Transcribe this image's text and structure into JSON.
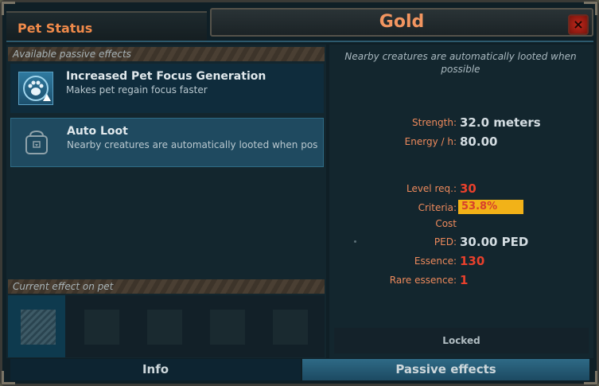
{
  "header": {
    "title": "Pet Status",
    "item_name": "Gold",
    "close_label": "×"
  },
  "available": {
    "heading": "Available passive effects",
    "effects": [
      {
        "name": "Increased Pet Focus Generation",
        "description": "Makes pet regain focus faster",
        "icon": "paw-icon"
      },
      {
        "name": "Auto Loot",
        "description": "Nearby creatures are automatically looted when possible",
        "icon": "loot-bag-icon"
      }
    ]
  },
  "current": {
    "heading": "Current effect on pet"
  },
  "details": {
    "description": "Nearby creatures are automatically looted when possible",
    "strength_label": "Strength:",
    "strength_value": "32.0 meters",
    "energy_label": "Energy / h:",
    "energy_value": "80.00",
    "level_label": "Level req.:",
    "level_value": "30",
    "criteria_label": "Criteria:",
    "criteria_value": "53.8%",
    "criteria_fraction": 0.538,
    "cost_label": "Cost",
    "ped_label": "PED:",
    "ped_value": "30.00 PED",
    "essence_label": "Essence:",
    "essence_value": "130",
    "rare_label": "Rare essence:",
    "rare_value": "1",
    "status": "Locked"
  },
  "tabs": {
    "info": "Info",
    "passive": "Passive effects"
  },
  "colors": {
    "accent_orange": "#f08a4a",
    "value_red": "#e8402c",
    "criteria_bar": "#f2b218",
    "selected_row": "#1f4a60"
  }
}
